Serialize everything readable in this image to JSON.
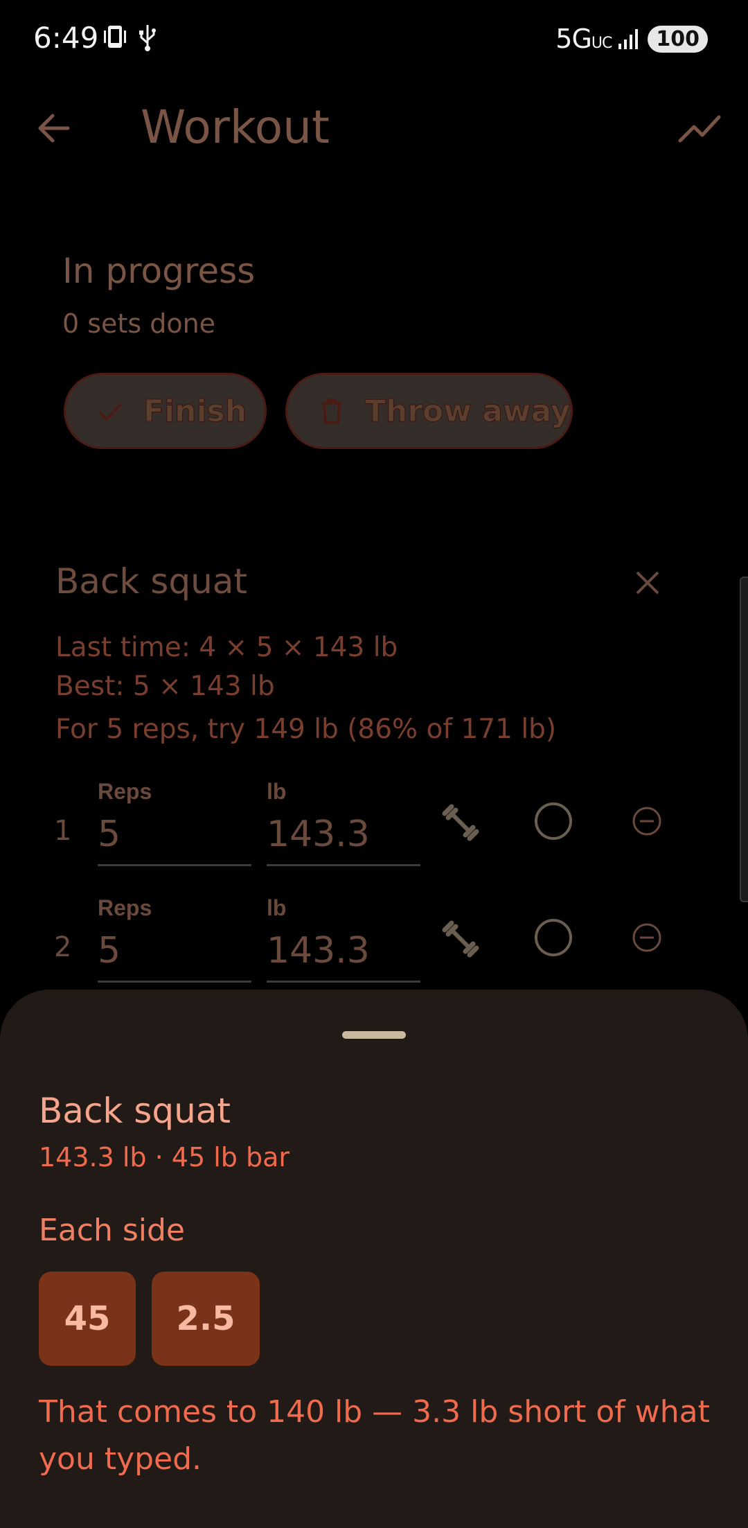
{
  "status": {
    "time": "6:49",
    "network": "5G",
    "network_sub": "UC",
    "battery": "100"
  },
  "app_bar": {
    "title": "Workout"
  },
  "progress": {
    "title": "In progress",
    "subtitle": "0 sets done",
    "finish_label": "Finish",
    "throw_label": "Throw away"
  },
  "exercise": {
    "title": "Back squat",
    "last_time": "Last time: 4 × 5 × 143 lb",
    "best": "Best: 5 × 143 lb",
    "suggestion": "For 5 reps, try 149 lb (86% of 171 lb)",
    "sets": [
      {
        "number": "1",
        "reps_label": "Reps",
        "reps": "5",
        "weight_label": "lb",
        "weight": "143.3"
      },
      {
        "number": "2",
        "reps_label": "Reps",
        "reps": "5",
        "weight_label": "lb",
        "weight": "143.3"
      }
    ]
  },
  "sheet": {
    "title": "Back squat",
    "subtitle": "143.3 lb · 45 lb bar",
    "section_label": "Each side",
    "plates": [
      "45",
      "2.5"
    ],
    "note": "That comes to 140 lb — 3.3 lb short of what you typed."
  },
  "colors": {
    "accent": "#f06b4e",
    "plate_bg": "#7a3318",
    "sheet_bg": "#221a16"
  }
}
